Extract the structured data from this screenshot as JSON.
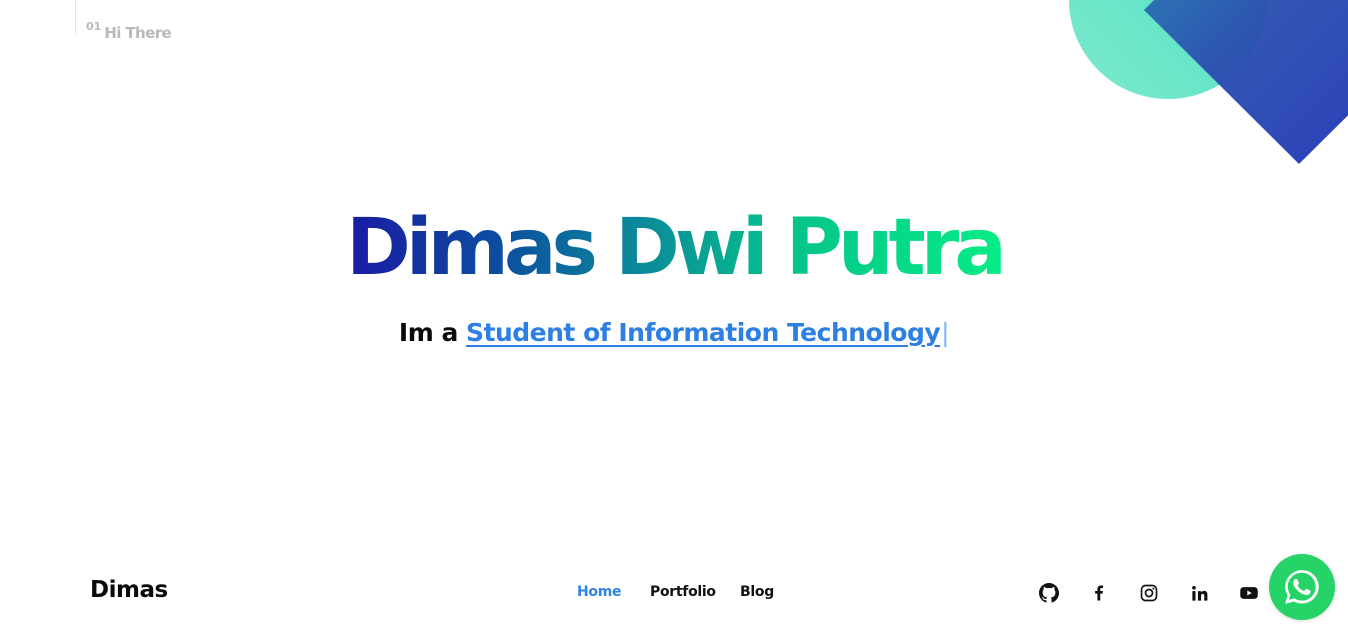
{
  "section": {
    "number": "01",
    "title": "Hi There"
  },
  "hero": {
    "name": "Dimas Dwi Putra",
    "intro_prefix": "Im a ",
    "role": "Student of Information Technology",
    "cursor": "|"
  },
  "brand": {
    "name": "Dimas"
  },
  "nav": {
    "items": [
      {
        "label": "Home",
        "active": true
      },
      {
        "label": "Portfolio",
        "active": false
      },
      {
        "label": "Blog",
        "active": false
      }
    ]
  },
  "social": {
    "icons": [
      "github-icon",
      "facebook-icon",
      "instagram-icon",
      "linkedin-icon",
      "youtube-icon"
    ]
  },
  "whatsapp": {
    "icon": "whatsapp-icon"
  },
  "colors": {
    "accent": "#2d84e6",
    "whatsapp": "#25d366",
    "gradient_start": "#1a1aa4",
    "gradient_end": "#06ec86",
    "deco_teal": "#5de8c6",
    "deco_blue": "#2537b8"
  }
}
